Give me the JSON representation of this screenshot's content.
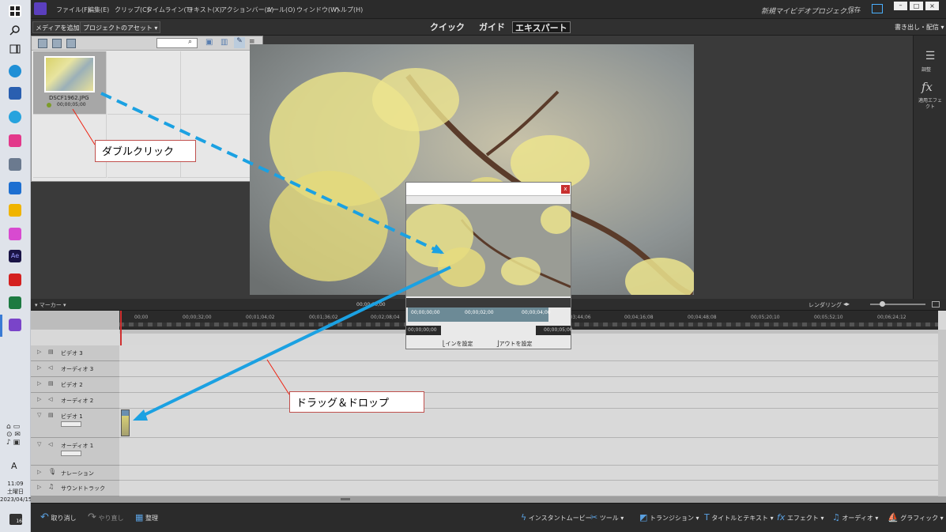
{
  "taskbar": {
    "time": "11:09",
    "day": "土曜日",
    "date": "2023/04/15",
    "ime": "A",
    "notification_count": "16"
  },
  "menu": {
    "items": [
      "ファイル(F)",
      "編集(E)",
      "クリップ(C)",
      "タイムライン(T)",
      "テキスト(X)",
      "アクションバー(A)",
      "ツール(O)",
      "ウィンドウ(W)",
      "ヘルプ(H)"
    ],
    "project_title": "新規マイビデオプロジェク...",
    "save_label": "保存"
  },
  "modes": {
    "quick": "クイック",
    "guide": "ガイド",
    "expert": "エキスパート",
    "add_media": "メディアを追加",
    "project_assets": "プロジェクトのアセット",
    "export": "書き出し・配信"
  },
  "assets": {
    "file_name": "DSCF1962.JPG",
    "duration": "00;00;05;00"
  },
  "right_panel": {
    "adjust": "調整",
    "applied_effects": "適用エフェクト"
  },
  "timeline": {
    "marker": "マーカー",
    "rendering": "レンダリング",
    "current_time": "00;00;00;00",
    "ruler_ticks": [
      "00;00",
      "00;00;32;00",
      "00;01;04;02",
      "00;01;36;02",
      "00;02;08;04",
      "00;03;44;06",
      "00;04;16;08",
      "00;04;48;08",
      "00;05;20;10",
      "00;05;52;10",
      "00;06;24;12"
    ],
    "tracks": [
      "ビデオ 3",
      "オーディオ 3",
      "ビデオ 2",
      "オーディオ 2",
      "ビデオ 1",
      "オーディオ 1",
      "ナレーション",
      "サウンドトラック"
    ]
  },
  "popup": {
    "close": "x",
    "start_time": "00;00;00;00",
    "mid_time": "00;00;02;00",
    "end_time": "00;00;04;00",
    "in_time": "00;00;00;00",
    "out_time": "00;00;05;00",
    "set_in": "インを設定",
    "set_out": "アウトを設定"
  },
  "bottom": {
    "undo": "取り消し",
    "redo": "やり直し",
    "organize": "整理",
    "instant_movie": "インスタントムービー",
    "tools": "ツール",
    "transitions": "トランジション",
    "titles": "タイトルとテキスト",
    "effects": "エフェクト",
    "audio": "オーディオ",
    "graphics": "グラフィック"
  },
  "annotations": {
    "double_click": "ダブルクリック",
    "drag_drop": "ドラッグ＆ドロップ"
  },
  "colors": {
    "accent": "#5b3fbe",
    "arrow": "#1ba1e2",
    "callout_border": "#c0504d"
  }
}
